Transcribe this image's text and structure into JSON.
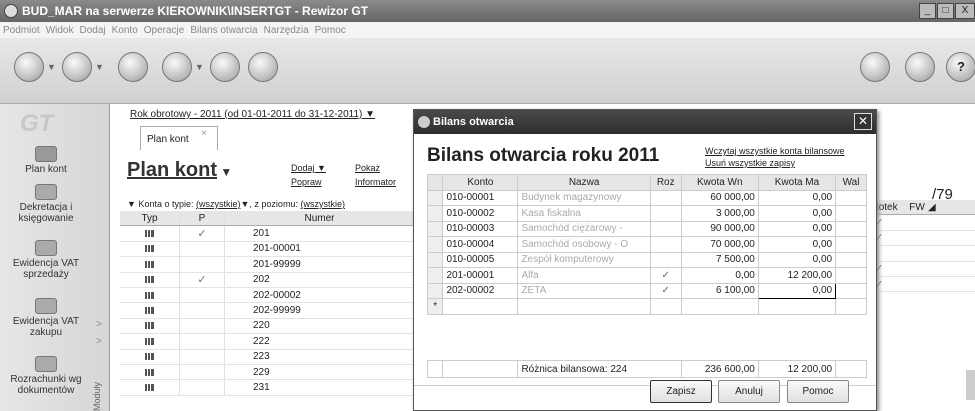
{
  "window": {
    "title": "BUD_MAR na serwerze KIEROWNIK\\INSERTGT - Rewizor GT",
    "min": "_",
    "max": "□",
    "close": "X"
  },
  "menu": [
    "Podmiot",
    "Widok",
    "Dodaj",
    "Konto",
    "Operacje",
    "Bilans otwarcia",
    "Narzędzia",
    "Pomoc"
  ],
  "toolbar": {
    "help": "?"
  },
  "sidebar": {
    "logo": "GT",
    "items": [
      {
        "label": "Plan kont"
      },
      {
        "label": "Dekretacja i księgowanie"
      },
      {
        "label": "Ewidencja VAT sprzedaży"
      },
      {
        "label": "Ewidencja VAT zakupu"
      },
      {
        "label": "Rozrachunki wg dokumentów"
      }
    ],
    "modules_label": "Moduły"
  },
  "main": {
    "year": "Rok obrotowy - 2011 (od 01-01-2011 do 31-12-2011)",
    "tab": "Plan kont",
    "tab_close": "×",
    "title": "Plan kont",
    "links": {
      "dodaj": "Dodaj",
      "poprawa": "Popraw",
      "pokaz": "Pokaż",
      "informator": "Informator"
    },
    "filter": {
      "label": "Konta o typie:",
      "typ": "(wszystkie)",
      "poziom_label": ", z poziomu:",
      "poziom": "(wszystkie)"
    },
    "columns": [
      "Typ",
      "P",
      "Numer"
    ],
    "rows": [
      {
        "p": "✓",
        "numer": "201"
      },
      {
        "p": "",
        "numer": "201-00001"
      },
      {
        "p": "",
        "numer": "201-99999"
      },
      {
        "p": "✓",
        "numer": "202"
      },
      {
        "p": "",
        "numer": "202-00002"
      },
      {
        "p": "",
        "numer": "202-99999"
      },
      {
        "p": "",
        "numer": "220"
      },
      {
        "p": "",
        "numer": "222"
      },
      {
        "p": "",
        "numer": "223"
      },
      {
        "p": "",
        "numer": "229"
      },
      {
        "p": "",
        "numer": "231"
      }
    ],
    "count": "/79",
    "right_columns": [
      "Kartotek",
      "FW"
    ],
    "right_checks": [
      "✓",
      "✓",
      "",
      "✓",
      "✓"
    ]
  },
  "dialog": {
    "title": "Bilans otwarcia",
    "close": "✕",
    "heading": "Bilans otwarcia roku 2011",
    "link_load": "Wczytaj wszystkie konta bilansowe",
    "link_delete": "Usuń wszystkie zapisy",
    "columns": [
      "Konto",
      "Nazwa",
      "Roz",
      "Kwota Wn",
      "Kwota Ma",
      "Wal"
    ],
    "rows": [
      {
        "konto": "010-00001",
        "nazwa": "Budynek magazynowy",
        "roz": "",
        "wn": "60 000,00",
        "ma": "0,00"
      },
      {
        "konto": "010-00002",
        "nazwa": "Kasa fiskalna",
        "roz": "",
        "wn": "3 000,00",
        "ma": "0,00"
      },
      {
        "konto": "010-00003",
        "nazwa": "Samochód ciężarowy -",
        "roz": "",
        "wn": "90 000,00",
        "ma": "0,00"
      },
      {
        "konto": "010-00004",
        "nazwa": "Samochód osobowy - O",
        "roz": "",
        "wn": "70 000,00",
        "ma": "0,00"
      },
      {
        "konto": "010-00005",
        "nazwa": "Zespół komputerowy",
        "roz": "",
        "wn": "7 500,00",
        "ma": "0,00"
      },
      {
        "konto": "201-00001",
        "nazwa": "Alfa",
        "roz": "✓",
        "wn": "0,00",
        "ma": "12 200,00"
      },
      {
        "konto": "202-00002",
        "nazwa": "ZETA",
        "roz": "✓",
        "wn": "6 100,00",
        "ma": "0,00"
      }
    ],
    "new_row_marker": "*",
    "summary": {
      "label": "Różnica bilansowa: 224",
      "wn": "236 600,00",
      "ma": "12 200,00"
    },
    "buttons": {
      "save": "Zapisz",
      "cancel": "Anuluj",
      "help": "Pomoc"
    }
  }
}
